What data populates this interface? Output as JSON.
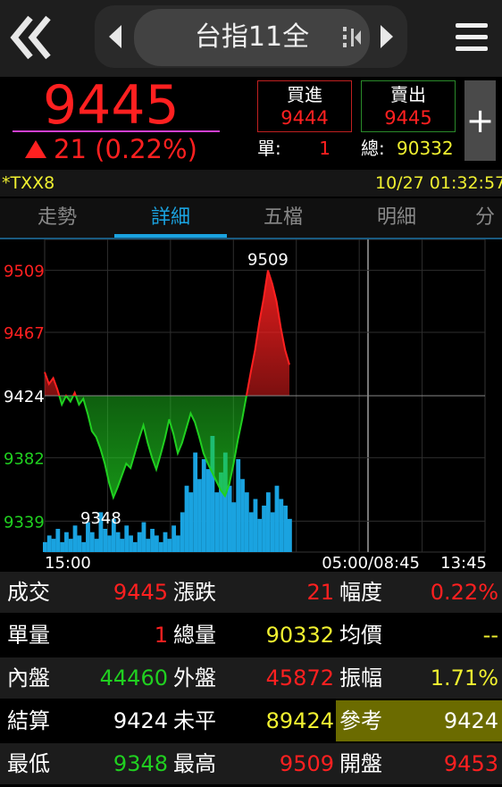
{
  "header": {
    "title": "台指11全"
  },
  "quote": {
    "last_price": "9445",
    "change": "21",
    "change_pct": "(0.22%)",
    "bid_label": "買進",
    "bid_value": "9444",
    "ask_label": "賣出",
    "ask_value": "9445",
    "single_label": "單:",
    "single_value": "1",
    "total_label": "總:",
    "total_value": "90332",
    "plus_label": "+"
  },
  "info": {
    "code": "*TXX8",
    "datetime": "10/27 01:32:57"
  },
  "tabs": [
    "走勢",
    "詳細",
    "五檔",
    "明細",
    "分"
  ],
  "active_tab": "詳細",
  "chart": {
    "y_ticks": [
      "9509",
      "9467",
      "9424",
      "9382",
      "9339"
    ],
    "x_ticks": [
      "15:00",
      "05:00/08:45",
      "13:45"
    ],
    "high_label": "9509",
    "low_label": "9348",
    "colors": {
      "up": "#ff2020",
      "down": "#20d020",
      "volume": "#1aa3e0",
      "ref": "#ffffff"
    }
  },
  "chart_data": {
    "type": "line",
    "title": "",
    "xlabel": "",
    "ylabel": "",
    "ylim": [
      9318,
      9530
    ],
    "reference": 9424,
    "series": [
      {
        "values": [
          9440,
          9432,
          9436,
          9428,
          9418,
          9424,
          9420,
          9426,
          9418,
          9422,
          9412,
          9400,
          9396,
          9388,
          9378,
          9365,
          9355,
          9362,
          9370,
          9378,
          9375,
          9385,
          9395,
          9404,
          9392,
          9382,
          9374,
          9384,
          9395,
          9408,
          9398,
          9385,
          9392,
          9402,
          9412,
          9406,
          9396,
          9385,
          9378,
          9372,
          9366,
          9360,
          9356,
          9364,
          9378,
          9394,
          9408,
          9424,
          9440,
          9455,
          9474,
          9490,
          9509,
          9500,
          9488,
          9470,
          9455,
          9445
        ]
      }
    ],
    "volume": [
      3,
      5,
      4,
      7,
      3,
      6,
      4,
      8,
      5,
      3,
      9,
      6,
      4,
      12,
      7,
      5,
      10,
      6,
      4,
      8,
      5,
      3,
      6,
      9,
      4,
      7,
      5,
      3,
      6,
      4,
      8,
      5,
      12,
      20,
      18,
      30,
      22,
      28,
      25,
      35,
      18,
      24,
      30,
      20,
      15,
      28,
      22,
      18,
      12,
      16,
      10,
      14,
      18,
      12,
      20,
      16,
      14,
      10
    ]
  },
  "table": {
    "rows": [
      [
        {
          "label": "成交",
          "value": "9445",
          "color": "#ff2020"
        },
        {
          "label": "漲跌",
          "value": "21",
          "color": "#ff2020"
        },
        {
          "label": "幅度",
          "value": "0.22%",
          "color": "#ff2020"
        }
      ],
      [
        {
          "label": "單量",
          "value": "1",
          "color": "#ff2020"
        },
        {
          "label": "總量",
          "value": "90332",
          "color": "#f0f030"
        },
        {
          "label": "均價",
          "value": "--",
          "color": "#f0f030"
        }
      ],
      [
        {
          "label": "內盤",
          "value": "44460",
          "color": "#20d020"
        },
        {
          "label": "外盤",
          "value": "45872",
          "color": "#ff2020"
        },
        {
          "label": "振幅",
          "value": "1.71%",
          "color": "#f0f030"
        }
      ],
      [
        {
          "label": "結算",
          "value": "9424",
          "color": "#ffffff"
        },
        {
          "label": "未平",
          "value": "89424",
          "color": "#f0f030"
        },
        {
          "label": "參考",
          "value": "9424",
          "color": "#ffffff"
        }
      ],
      [
        {
          "label": "最低",
          "value": "9348",
          "color": "#20d020"
        },
        {
          "label": "最高",
          "value": "9509",
          "color": "#ff2020"
        },
        {
          "label": "開盤",
          "value": "9453",
          "color": "#ff2020"
        }
      ]
    ]
  }
}
